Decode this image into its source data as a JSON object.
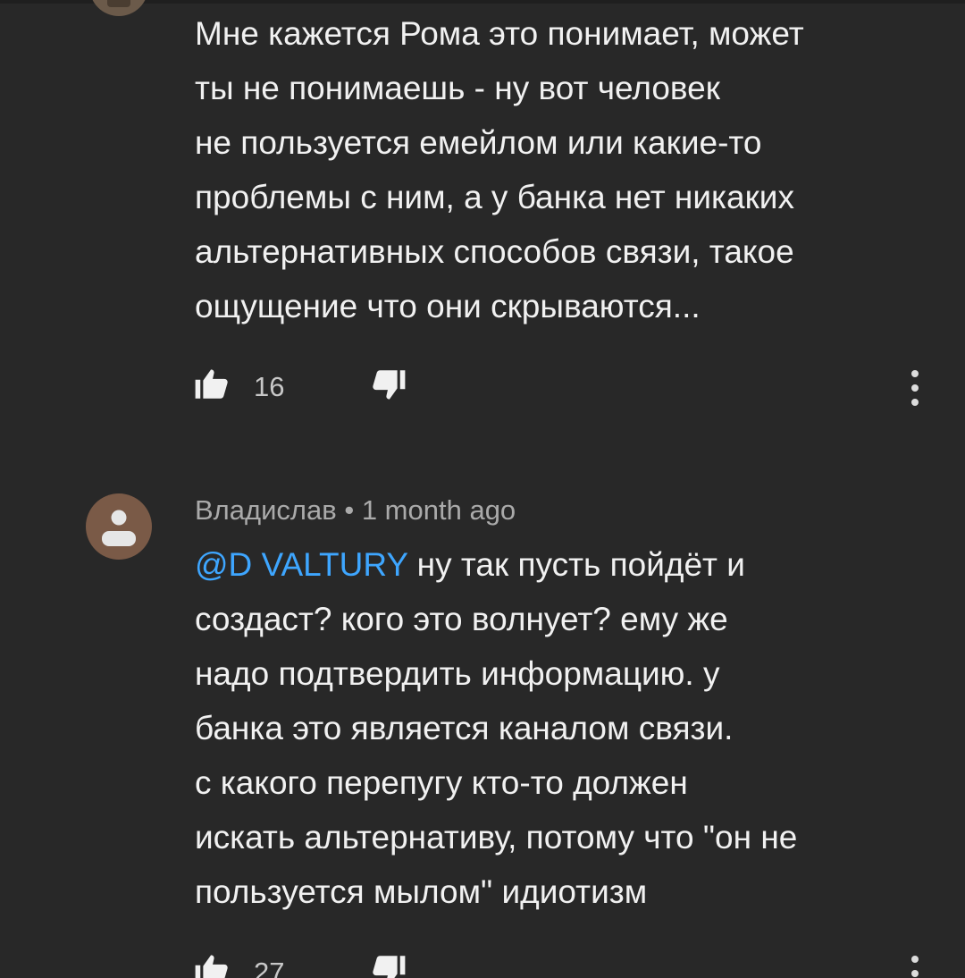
{
  "comment_1": {
    "text_lines": [
      "Мне кажется Рома это понимает, может",
      "ты не понимаешь - ну вот человек",
      "не пользуется емейлом или какие-то",
      "проблемы с ним, а у банка нет никаких",
      "альтернативных способов связи, такое",
      "ощущение что они скрываются..."
    ],
    "likes": "16"
  },
  "comment_2": {
    "author": "Владислав",
    "separator": "•",
    "time": "1 month ago",
    "mention": "@D VALTURY",
    "text_first": " ну так пусть пойдёт и",
    "text_lines": [
      "создаст? кого это волнует? ему же",
      "надо подтвердить информацию. у",
      "банка это является каналом связи.",
      "с какого перепугу кто-то должен",
      "искать альтернативу, потому что \"он не",
      "пользуется мылом\" идиотизм"
    ],
    "likes": "27"
  },
  "icons": {
    "like": "thumb-up-icon",
    "dislike": "thumb-down-icon",
    "more": "more-vertical-icon",
    "avatar": "default-user-avatar"
  },
  "colors": {
    "background": "#282828",
    "text": "#f1f1f1",
    "secondary": "#aaaaaa",
    "mention": "#3ea6ff"
  }
}
